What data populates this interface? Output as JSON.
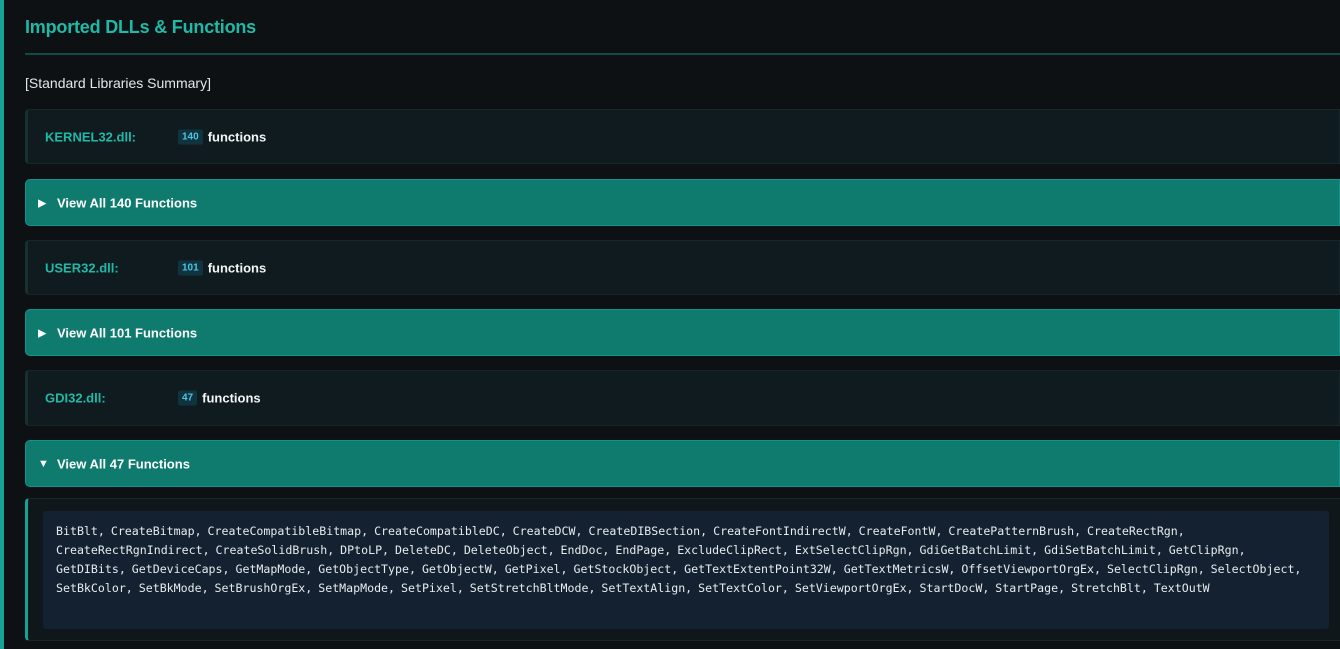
{
  "section": {
    "title": "Imported DLLs & Functions",
    "summary_label": "[Standard Libraries Summary]"
  },
  "dlls": [
    {
      "name": "KERNEL32.dll:",
      "count": "140",
      "unit": "functions",
      "toggle_label": "View All 140 Functions",
      "expanded": false,
      "arrow": "▶"
    },
    {
      "name": "USER32.dll:",
      "count": "101",
      "unit": "functions",
      "toggle_label": "View All 101 Functions",
      "expanded": false,
      "arrow": "▶"
    },
    {
      "name": "GDI32.dll:",
      "count": "47",
      "unit": "functions",
      "toggle_label": "View All 47 Functions",
      "expanded": true,
      "arrow": "▼",
      "functions_text": "BitBlt, CreateBitmap, CreateCompatibleBitmap, CreateCompatibleDC, CreateDCW, CreateDIBSection, CreateFontIndirectW, CreateFontW, CreatePatternBrush, CreateRectRgn, CreateRectRgnIndirect, CreateSolidBrush, DPtoLP, DeleteDC, DeleteObject, EndDoc, EndPage, ExcludeClipRect, ExtSelectClipRgn, GdiGetBatchLimit, GdiSetBatchLimit, GetClipRgn, GetDIBits, GetDeviceCaps, GetMapMode, GetObjectType, GetObjectW, GetPixel, GetStockObject, GetTextExtentPoint32W, GetTextMetricsW, OffsetViewportOrgEx, SelectClipRgn, SelectObject, SetBkColor, SetBkMode, SetBrushOrgEx, SetMapMode, SetPixel, SetStretchBltMode, SetTextAlign, SetTextColor, SetViewportOrgEx, StartDocW, StartPage, StretchBlt, TextOutW"
    }
  ],
  "colors": {
    "accent": "#1fb9a7",
    "toggle_bg": "#0f7a6e",
    "page_bg": "#0d1114",
    "badge_text": "#4fc3e0"
  },
  "icons": {
    "collapsed": "triangle-right-icon",
    "expanded": "triangle-down-icon"
  }
}
